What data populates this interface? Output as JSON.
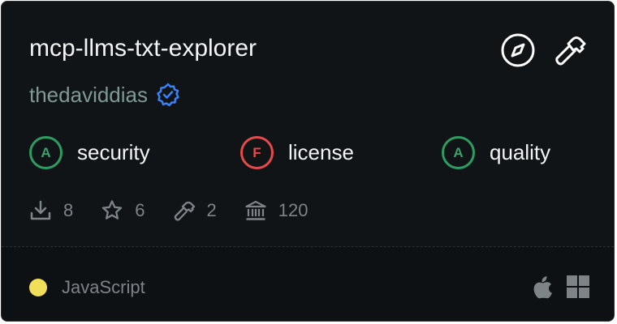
{
  "repo": {
    "name": "mcp-llms-txt-explorer",
    "author": "thedaviddias",
    "verified_icon": "verified-badge-icon"
  },
  "actions": [
    {
      "icon": "compass-icon"
    },
    {
      "icon": "hammer-icon"
    }
  ],
  "grades": [
    {
      "grade": "A",
      "label": "security",
      "status": "pass"
    },
    {
      "grade": "F",
      "label": "license",
      "status": "fail"
    },
    {
      "grade": "A",
      "label": "quality",
      "status": "pass"
    }
  ],
  "stats": {
    "downloads": "8",
    "stars": "6",
    "tools": "2",
    "score": "120"
  },
  "footer": {
    "language": "JavaScript",
    "language_color": "#f1df5a",
    "platforms": [
      "apple-icon",
      "windows-icon"
    ]
  },
  "colors": {
    "pass": "#2e9b61",
    "fail": "#e44a4a",
    "verified": "#3b82f6"
  }
}
